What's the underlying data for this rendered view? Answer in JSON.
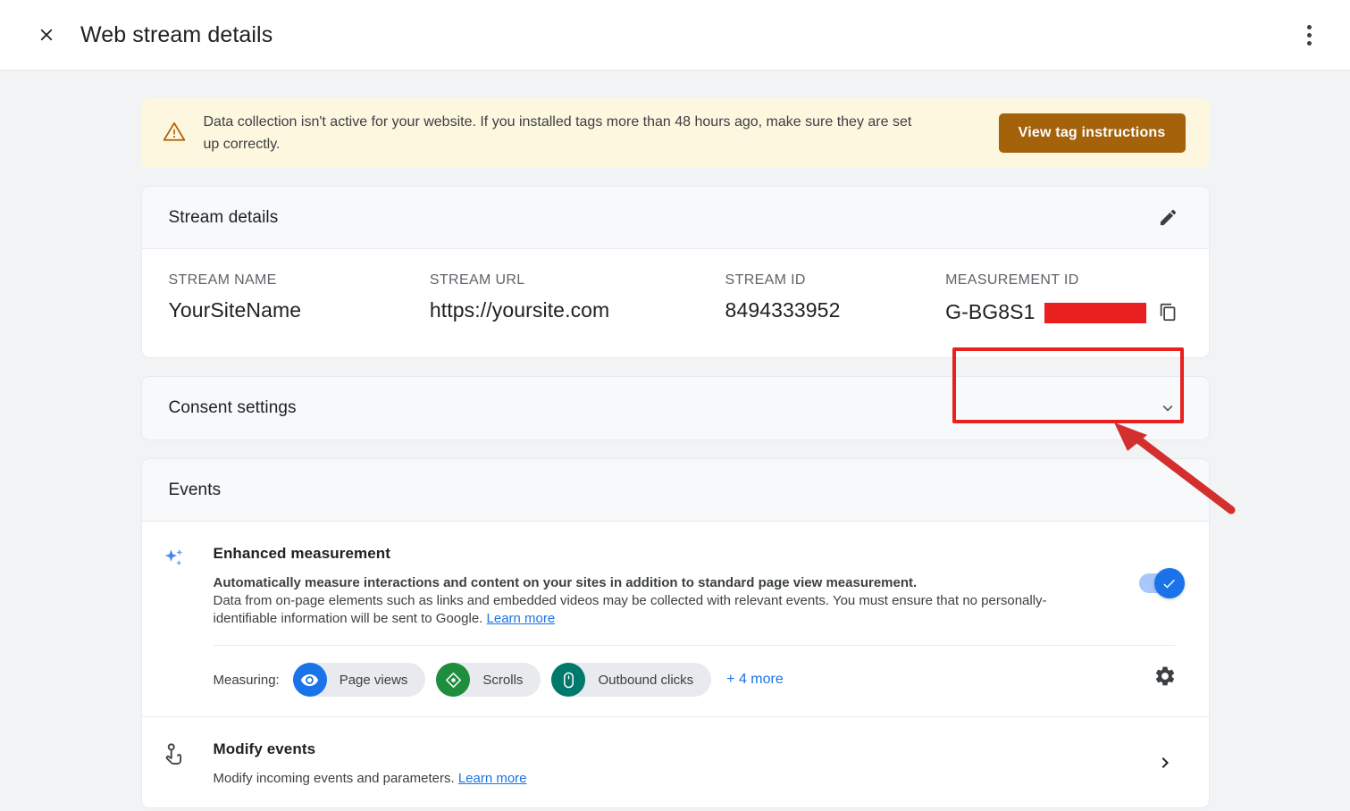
{
  "appbar": {
    "title": "Web stream details",
    "close_icon": "close-icon",
    "menu_icon": "more-vert-icon"
  },
  "banner": {
    "icon": "warning-triangle-icon",
    "message": "Data collection isn't active for your website. If you installed tags more than 48 hours ago, make sure they are set up correctly.",
    "button_label": "View tag instructions",
    "button_color": "#a4620b",
    "background_color": "#fef7e0"
  },
  "stream_details": {
    "section_title": "Stream details",
    "edit_icon": "pencil-edit-icon",
    "fields": [
      {
        "label": "STREAM NAME",
        "value": "YourSiteName"
      },
      {
        "label": "STREAM URL",
        "value": "https://yoursite.com"
      },
      {
        "label": "STREAM ID",
        "value": "8494333952"
      },
      {
        "label": "MEASUREMENT ID",
        "value": "G-BG8S1",
        "redacted": true,
        "copy_icon": "copy-icon"
      }
    ],
    "highlight_color": "#e8201f",
    "redaction_color": "#e8201f"
  },
  "consent": {
    "section_title": "Consent settings",
    "chevron_icon": "chevron-down-icon"
  },
  "events": {
    "section_title": "Events",
    "rows": [
      {
        "icon": "sparkles-icon",
        "title": "Enhanced measurement",
        "desc_bold": "Automatically measure interactions and content on your sites in addition to standard page view measurement.",
        "desc_rest": "Data from on-page elements such as links and embedded videos may be collected with relevant events. You must ensure that no personally-identifiable information will be sent to Google. ",
        "learn_more": "Learn more",
        "toggle_on": true,
        "measuring_label": "Measuring:",
        "chips": [
          {
            "label": "Page views",
            "icon": "eye-icon",
            "color": "#1a73e8"
          },
          {
            "label": "Scrolls",
            "icon": "scroll-diamond-icon",
            "color": "#1e8e3e"
          },
          {
            "label": "Outbound clicks",
            "icon": "mouse-icon",
            "color": "#00796b"
          }
        ],
        "more_label": "+ 4 more",
        "settings_icon": "gear-icon"
      },
      {
        "icon": "tap-hand-icon",
        "title": "Modify events",
        "desc_rest": "Modify incoming events and parameters. ",
        "learn_more": "Learn more",
        "chevron_icon": "chevron-right-icon"
      }
    ]
  }
}
